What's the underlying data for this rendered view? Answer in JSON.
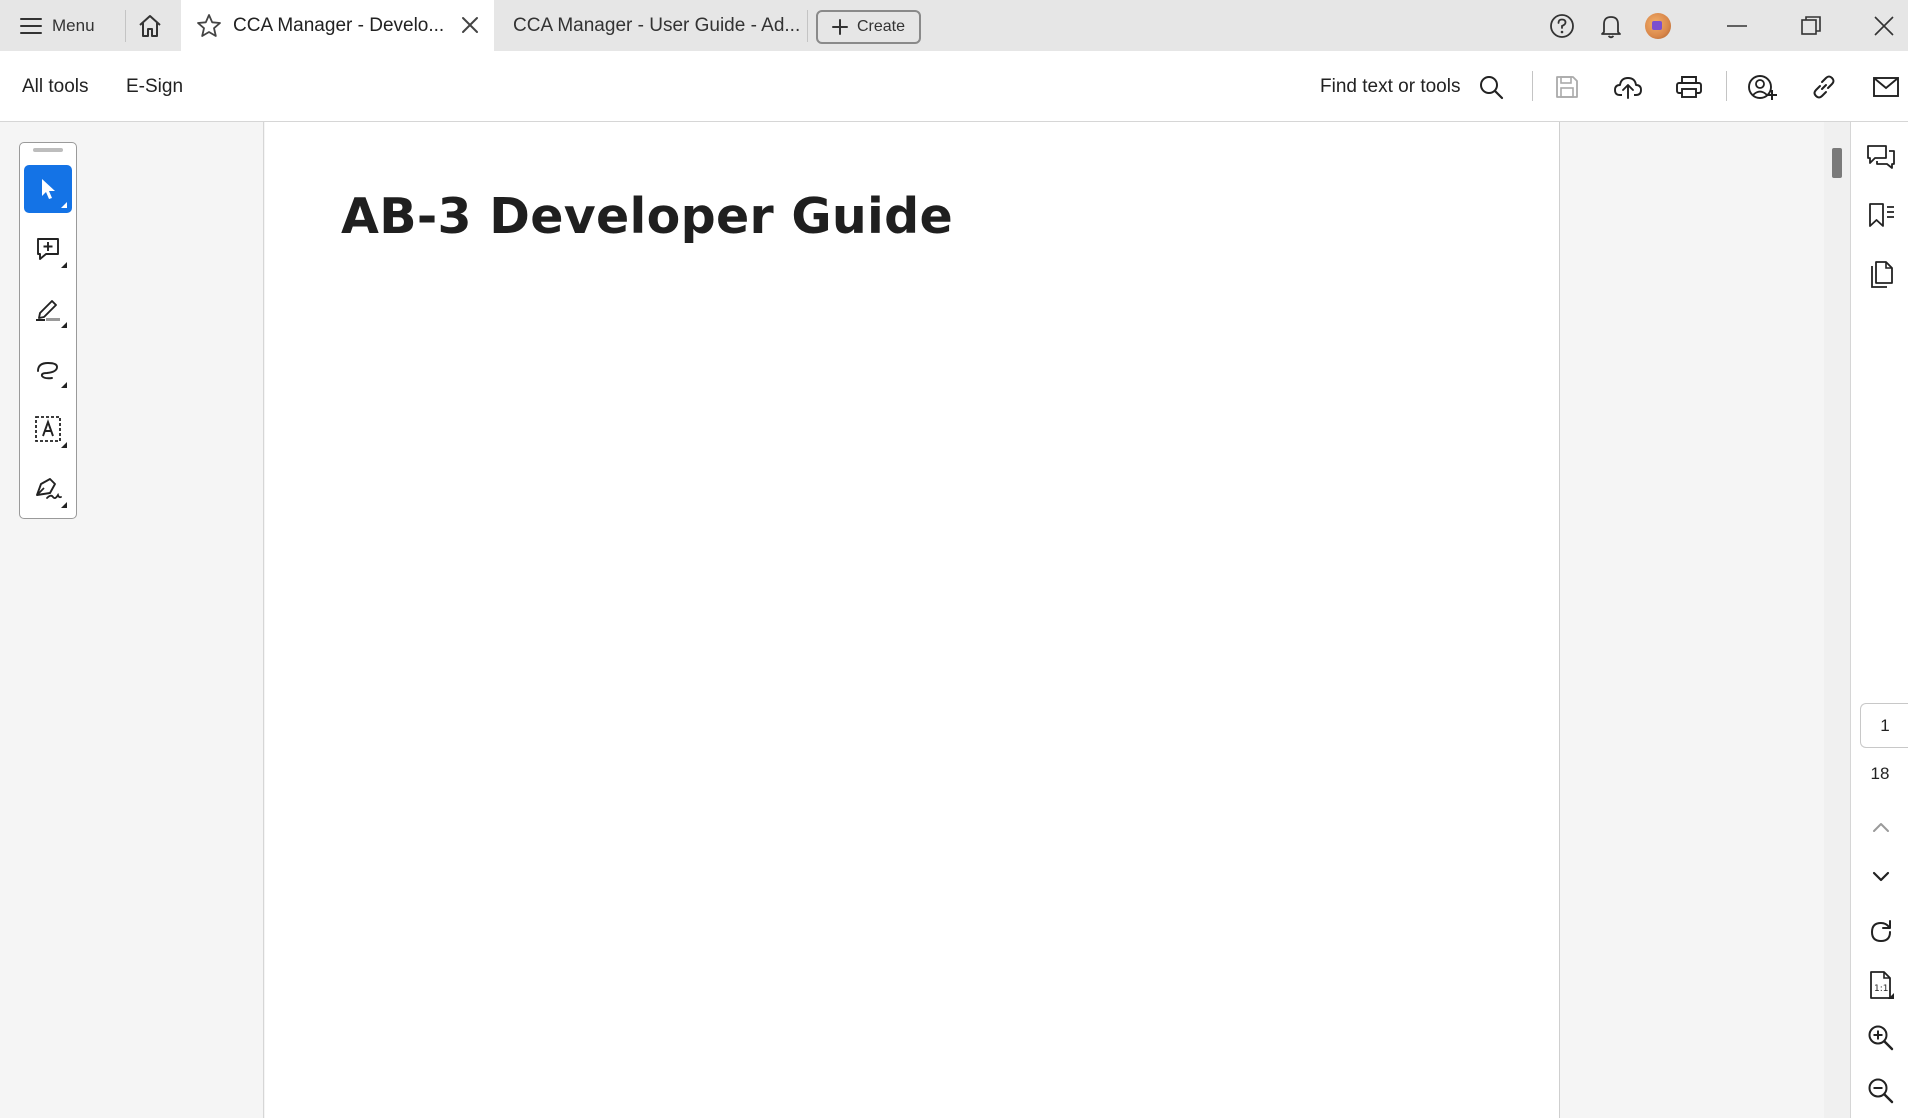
{
  "titlebar": {
    "menu_label": "Menu",
    "tabs": [
      {
        "label": "CCA Manager - Develo...",
        "active": true
      },
      {
        "label": "CCA Manager - User Guide - Ad...",
        "active": false
      }
    ],
    "create_label": "Create"
  },
  "toolbar": {
    "all_tools_label": "All tools",
    "esign_label": "E-Sign",
    "find_label": "Find text or tools"
  },
  "document": {
    "title": "AB-3 Developer Guide"
  },
  "navigation": {
    "current_page": "1",
    "total_pages": "18"
  },
  "colors": {
    "accent": "#1473e6",
    "titlebar_bg": "#e6e6e6",
    "canvas_bg": "#f5f5f5"
  },
  "icons": {
    "titlebar": [
      "hamburger-icon",
      "home-icon",
      "star-icon",
      "close-tab-icon",
      "plus-icon",
      "help-icon",
      "bell-icon",
      "avatar",
      "minimize-icon",
      "restore-icon",
      "close-window-icon"
    ],
    "toolbar": [
      "search-icon",
      "save-icon",
      "cloud-upload-icon",
      "print-icon",
      "share-user-icon",
      "link-icon",
      "mail-icon"
    ],
    "left_rail": [
      "select-cursor-icon",
      "add-comment-icon",
      "highlight-pen-icon",
      "draw-freehand-icon",
      "text-box-icon",
      "sign-icon"
    ],
    "right_rail": [
      "comments-icon",
      "bookmarks-icon",
      "pages-icon",
      "chevron-up-icon",
      "chevron-down-icon",
      "rotate-icon",
      "actual-size-icon",
      "zoom-in-icon",
      "zoom-out-icon"
    ]
  }
}
